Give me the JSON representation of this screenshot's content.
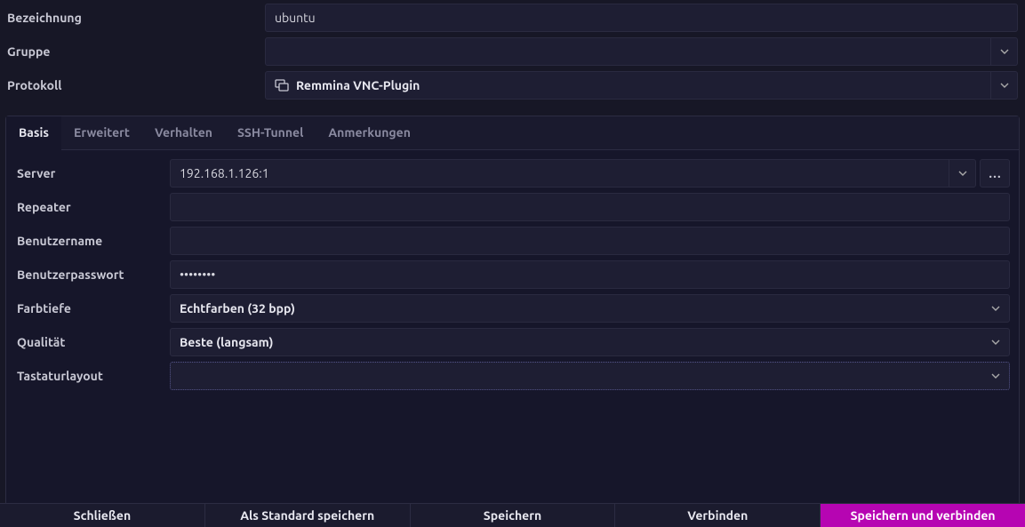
{
  "header": {
    "name_label": "Bezeichnung",
    "name_value": "ubuntu",
    "group_label": "Gruppe",
    "group_value": "",
    "protocol_label": "Protokoll",
    "protocol_value": "Remmina VNC-Plugin"
  },
  "tabs": {
    "basis": "Basis",
    "erweitert": "Erweitert",
    "verhalten": "Verhalten",
    "sshtunnel": "SSH-Tunnel",
    "anmerkungen": "Anmerkungen"
  },
  "basis": {
    "server_label": "Server",
    "server_value": "192.168.1.126:1",
    "repeater_label": "Repeater",
    "repeater_value": "",
    "username_label": "Benutzername",
    "username_value": "",
    "password_label": "Benutzerpasswort",
    "password_value": "••••••••",
    "colordepth_label": "Farbtiefe",
    "colordepth_value": "Echtfarben (32 bpp)",
    "quality_label": "Qualität",
    "quality_value": "Beste (langsam)",
    "keyboard_label": "Tastaturlayout",
    "keyboard_value": ""
  },
  "buttons": {
    "close": "Schließen",
    "save_default": "Als Standard speichern",
    "save": "Speichern",
    "connect": "Verbinden",
    "save_connect": "Speichern und verbinden",
    "more": "…"
  }
}
